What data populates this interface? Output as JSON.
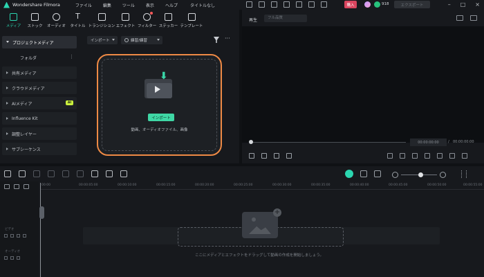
{
  "titlebar": {
    "app_name": "Wondershare Filmora",
    "menu": [
      "ファイル",
      "編集",
      "ツール",
      "表示",
      "ヘルプ"
    ],
    "doc_title": "タイトルなし",
    "buy_label": "購入",
    "coin_count": "918",
    "export_label": "エクスポート"
  },
  "media_tabs": [
    {
      "label": "メディア",
      "icon": "media-icon",
      "active": true
    },
    {
      "label": "ストック",
      "icon": "stock-icon"
    },
    {
      "label": "オーディオ",
      "icon": "audio-icon"
    },
    {
      "label": "タイトル",
      "icon": "title-icon"
    },
    {
      "label": "トランジション",
      "icon": "transition-icon"
    },
    {
      "label": "エフェクト",
      "icon": "effect-icon"
    },
    {
      "label": "フィルター",
      "icon": "filter-icon"
    },
    {
      "label": "ステッカー",
      "icon": "sticker-icon"
    },
    {
      "label": "テンプレート",
      "icon": "template-icon"
    }
  ],
  "side_nav": {
    "project_media": "プロジェクトメディア",
    "folder": "フォルダ",
    "shared_media": "共有メディア",
    "cloud_media": "クラウドメディア",
    "ai_media": "AIメディア",
    "ai_badge": "AI",
    "influence_kit": "Influence Kit",
    "adjustment_layer": "調整レイヤー",
    "subsequence": "サブシーケンス"
  },
  "toolbar": {
    "import_label": "インポート",
    "sort_label": "練習/練習"
  },
  "drop_area": {
    "import_button": "インポート",
    "hint": "動画、オーディオファイル、画像"
  },
  "preview": {
    "label": "再生",
    "select_value": "フル品質",
    "current_time": "00:00:00:00",
    "slash": "/",
    "total_time": "00:00:00:00"
  },
  "timeline": {
    "ticks": [
      "00:00",
      "00:00:05:00",
      "00:00:10:00",
      "00:00:15:00",
      "00:00:20:00",
      "00:00:25:00",
      "00:00:30:00",
      "00:00:35:00",
      "00:00:40:00",
      "00:00:45:00",
      "00:00:50:00",
      "00:00:55:00"
    ],
    "video_track": "ビデオ",
    "audio_track": "オーディオ",
    "hint": "ここにメディアとエフェクトをドラッグして動画の作成を開始しましょう。"
  },
  "colors": {
    "accent": "#2bd6b0",
    "drop_border": "#ef8a45",
    "buy": "#d9455f"
  }
}
